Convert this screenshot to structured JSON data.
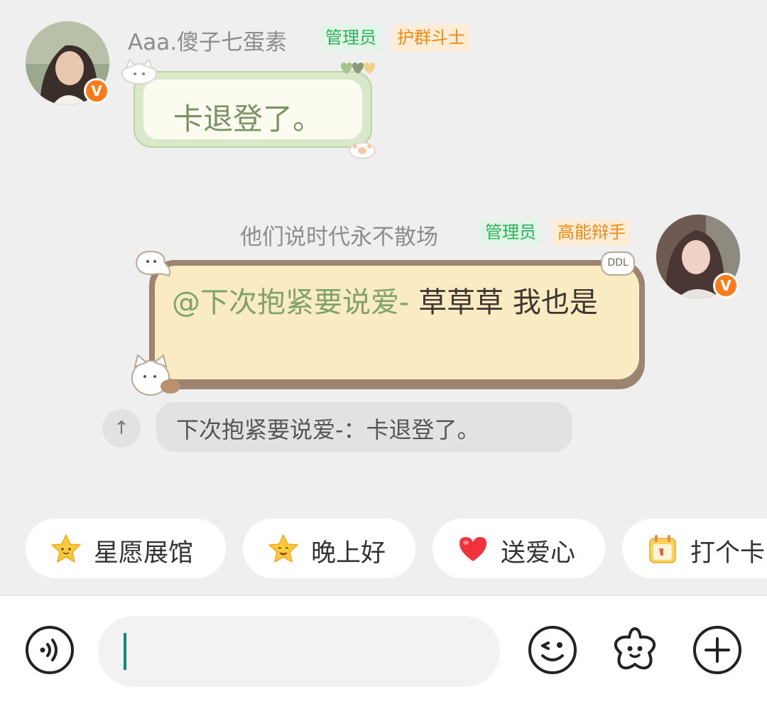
{
  "messages": [
    {
      "sender": "Aaa.傻子七蛋素",
      "tags": [
        "管理员",
        "护群斗士"
      ],
      "text": "卡退登了。",
      "badge": "V"
    },
    {
      "sender": "他们说时代永不散场",
      "tags": [
        "管理员",
        "高能辩手"
      ],
      "mention": "@下次抱紧要说爱-",
      "text": " 草草草 我也是",
      "badge": "V",
      "sticker": "DDL"
    }
  ],
  "quote": {
    "icon": "↑",
    "text": "下次抱紧要说爱-：卡退登了。"
  },
  "quick_replies": [
    {
      "label": "星愿展馆",
      "icon": "star-icon"
    },
    {
      "label": "晚上好",
      "icon": "star-smile-icon"
    },
    {
      "label": "送爱心",
      "icon": "heart-icon"
    },
    {
      "label": "打个卡",
      "icon": "calendar-icon"
    }
  ],
  "input": {
    "value": "",
    "placeholder": ""
  },
  "colors": {
    "admin_tag": "#2bb35a",
    "orange_tag": "#f08a12",
    "mention": "#7ea36b",
    "caret": "#0d8a7e"
  }
}
